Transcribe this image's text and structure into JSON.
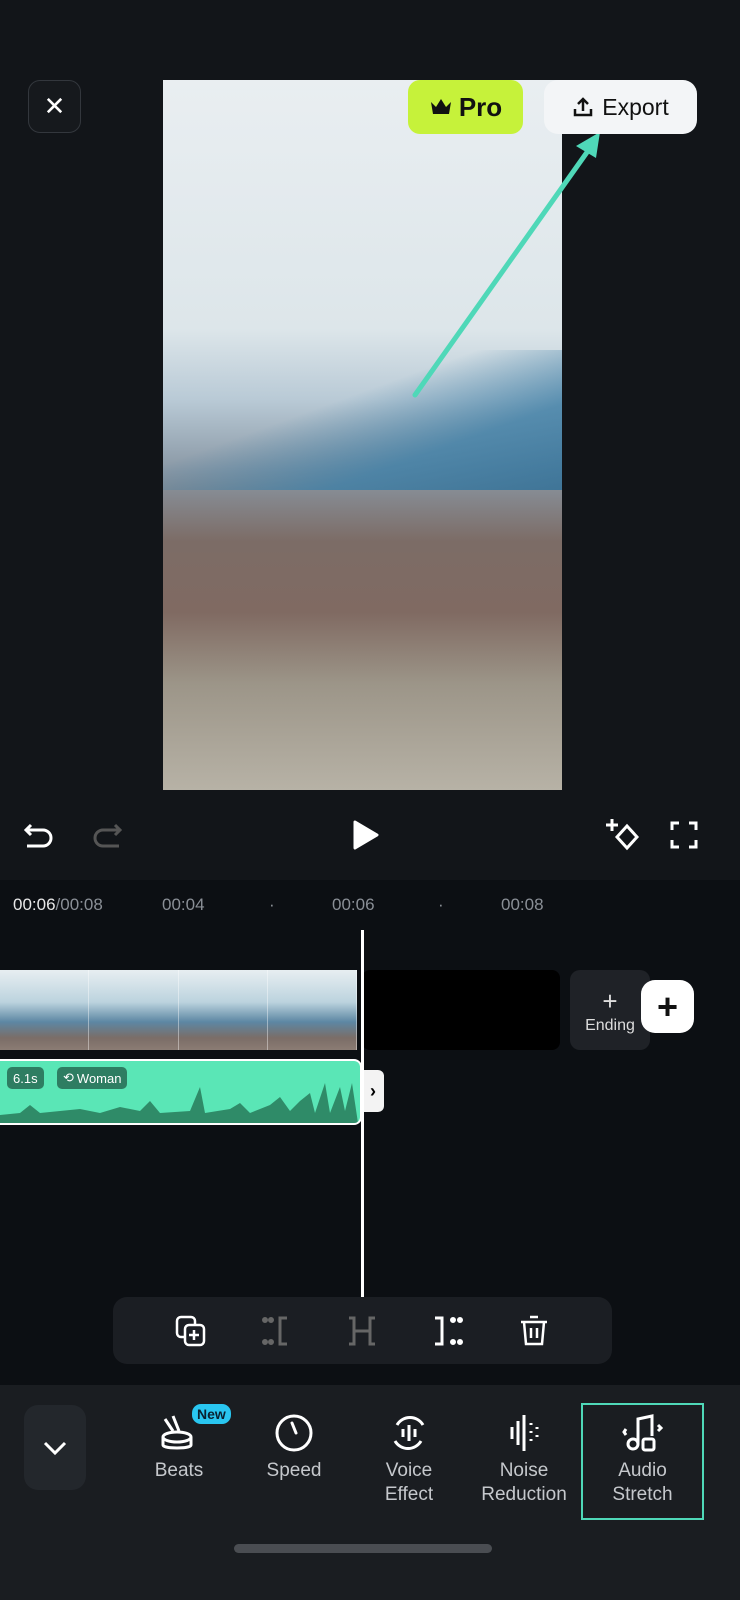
{
  "header": {
    "close_icon": "close-icon",
    "pro_label": "Pro",
    "export_label": "Export"
  },
  "annotation": {
    "color": "#4fd8b8"
  },
  "timeline": {
    "current_time": "00:06",
    "total_time": "/00:08",
    "ticks": [
      "00:04",
      "00:06",
      "00:08"
    ],
    "ending_label": "Ending",
    "audio_duration": "6.1s",
    "audio_voice": "Woman"
  },
  "tools": [
    {
      "label": "Beats",
      "badge": "New"
    },
    {
      "label": "Speed"
    },
    {
      "label": "Voice\nEffect"
    },
    {
      "label": "Noise\nReduction"
    },
    {
      "label": "Audio\nStretch",
      "selected": true
    }
  ],
  "colors": {
    "pro": "#c6f23a",
    "audio_track": "#5ae6b6",
    "accent": "#4fd8b8"
  }
}
